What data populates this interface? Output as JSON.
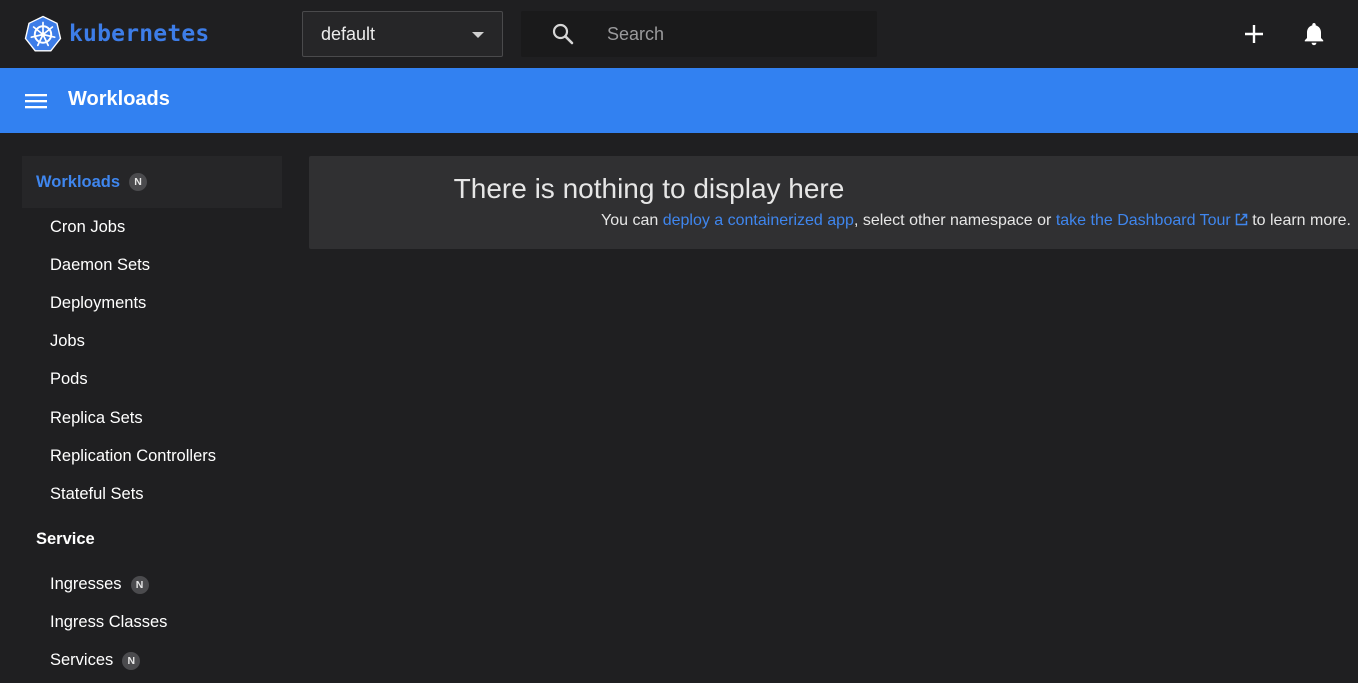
{
  "brand": {
    "name": "kubernetes",
    "logo_icon": "kubernetes-helm-icon",
    "color": "#3d7de8"
  },
  "namespace_select": {
    "value": "default"
  },
  "search": {
    "placeholder": "Search"
  },
  "header": {
    "title": "Workloads",
    "color": "#3281f1"
  },
  "sidebar": {
    "workloads": {
      "label": "Workloads",
      "badge": "N",
      "items": [
        {
          "label": "Cron Jobs"
        },
        {
          "label": "Daemon Sets"
        },
        {
          "label": "Deployments"
        },
        {
          "label": "Jobs"
        },
        {
          "label": "Pods"
        },
        {
          "label": "Replica Sets"
        },
        {
          "label": "Replication Controllers"
        },
        {
          "label": "Stateful Sets"
        }
      ]
    },
    "service": {
      "label": "Service",
      "items": [
        {
          "label": "Ingresses",
          "badge": "N"
        },
        {
          "label": "Ingress Classes"
        },
        {
          "label": "Services",
          "badge": "N"
        }
      ]
    }
  },
  "empty_state": {
    "title": "There is nothing to display here",
    "prefix": "You can ",
    "deploy_link": "deploy a containerized app",
    "middle": ", select other namespace or ",
    "tour_link": "take the Dashboard Tour",
    "suffix": " to learn more."
  },
  "colors": {
    "background": "#1f1f21",
    "card": "#303032",
    "link": "#3f86ee"
  }
}
